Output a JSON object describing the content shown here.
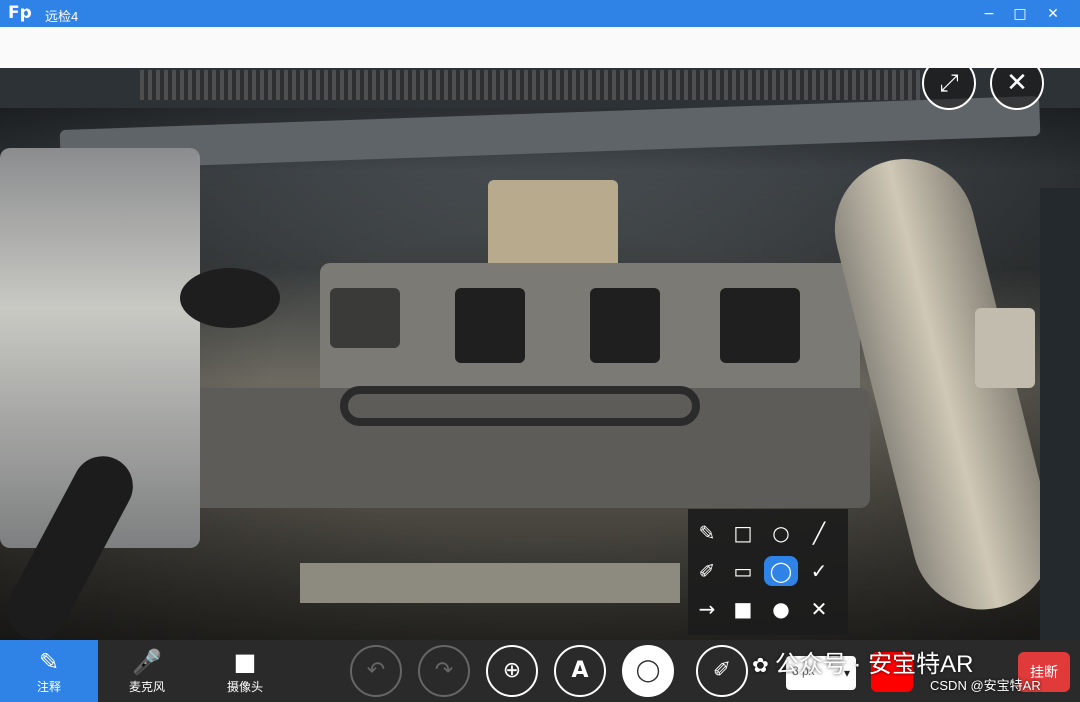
{
  "titlebar": {
    "logo_text": "Fp",
    "title": "远检4",
    "controls": {
      "minimize": "−",
      "maximize": "□",
      "close": "✕"
    }
  },
  "video_controls": {
    "fullscreen_icon": "⤢",
    "close_icon": "✕"
  },
  "annotation_palette": {
    "selected_tool": "ellipse-outline",
    "row1": [
      "✎",
      "□",
      "○",
      "╱"
    ],
    "row2": [
      "✐",
      "▭",
      "◯",
      "✓"
    ],
    "row3": [
      "→",
      "■",
      "●",
      "✕"
    ]
  },
  "bottombar": {
    "annotate_label": "注释",
    "mic_label": "麦克风",
    "camera_label": "摄像头",
    "annotate_icon": "✎",
    "mic_icon": "🎤",
    "camera_icon": "■",
    "undo_icon": "↶",
    "redo_icon": "↷",
    "zoom_icon": "⊕",
    "text_icon": "A",
    "shape_icon": "◯",
    "brush_icon": "✐",
    "line_width_value": "8 px",
    "line_width_arrow": "▾",
    "color": "#ff0000",
    "hangup_label": "挂断"
  },
  "watermark": {
    "wechat_icon": "✿",
    "main_text": "公众号 · 安宝特AR",
    "csdn_text": "CSDN @安宝特AR"
  },
  "colors": {
    "accent": "#2f82e6",
    "toolbar_bg": "#2a2a2a",
    "danger": "#e03a3a"
  }
}
